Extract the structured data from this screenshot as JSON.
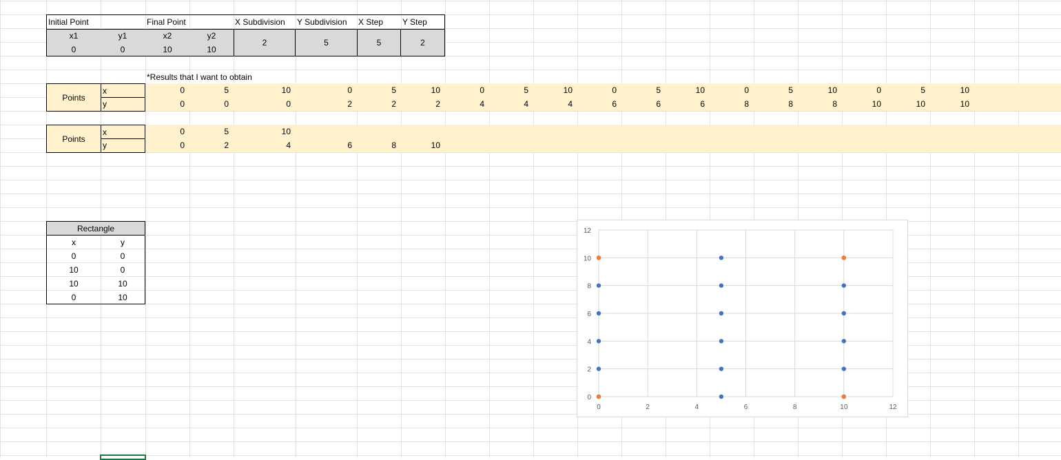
{
  "params": {
    "headers": {
      "initial": "Initial Point",
      "final": "Final Point",
      "xsub": "X Subdivision",
      "ysub": "Y Subdivision",
      "xstep": "X Step",
      "ystep": "Y Step"
    },
    "sub_headers": {
      "x1": "x1",
      "y1": "y1",
      "x2": "x2",
      "y2": "y2"
    },
    "values": {
      "x1": "0",
      "y1": "0",
      "x2": "10",
      "y2": "10",
      "xsub": "2",
      "ysub": "5",
      "xstep": "5",
      "ystep": "2"
    }
  },
  "note": "*Results that I want to obtain",
  "points1": {
    "label": "Points",
    "x_label": "x",
    "y_label": "y",
    "x": [
      "0",
      "5",
      "10",
      "0",
      "5",
      "10",
      "0",
      "5",
      "10",
      "0",
      "5",
      "10",
      "0",
      "5",
      "10",
      "0",
      "5",
      "10"
    ],
    "y": [
      "0",
      "0",
      "0",
      "2",
      "2",
      "2",
      "4",
      "4",
      "4",
      "6",
      "6",
      "6",
      "8",
      "8",
      "8",
      "10",
      "10",
      "10"
    ]
  },
  "points2": {
    "label": "Points",
    "x_label": "x",
    "y_label": "y",
    "x": [
      "0",
      "5",
      "10"
    ],
    "y": [
      "0",
      "2",
      "4",
      "6",
      "8",
      "10"
    ]
  },
  "rectangle": {
    "title": "Rectangle",
    "x_label": "x",
    "y_label": "y",
    "rows": [
      [
        "0",
        "0"
      ],
      [
        "10",
        "0"
      ],
      [
        "10",
        "10"
      ],
      [
        "0",
        "10"
      ]
    ]
  },
  "chart_data": {
    "type": "scatter",
    "xlim": [
      0,
      12
    ],
    "ylim": [
      0,
      12
    ],
    "x_ticks": [
      "0",
      "2",
      "4",
      "6",
      "8",
      "10",
      "12"
    ],
    "y_ticks": [
      "0",
      "2",
      "4",
      "6",
      "8",
      "10",
      "12"
    ],
    "grid": true,
    "series": [
      {
        "color": "#4472c4",
        "points": [
          [
            0,
            0
          ],
          [
            0,
            2
          ],
          [
            0,
            4
          ],
          [
            0,
            6
          ],
          [
            0,
            8
          ],
          [
            0,
            10
          ],
          [
            5,
            0
          ],
          [
            5,
            2
          ],
          [
            5,
            4
          ],
          [
            5,
            6
          ],
          [
            5,
            8
          ],
          [
            5,
            10
          ],
          [
            10,
            0
          ],
          [
            10,
            2
          ],
          [
            10,
            4
          ],
          [
            10,
            6
          ],
          [
            10,
            8
          ],
          [
            10,
            10
          ]
        ]
      },
      {
        "color": "#ed7d31",
        "points": [
          [
            0,
            0
          ],
          [
            10,
            0
          ],
          [
            10,
            10
          ],
          [
            0,
            10
          ]
        ]
      }
    ]
  }
}
